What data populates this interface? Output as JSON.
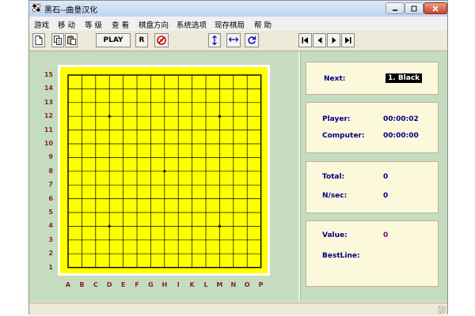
{
  "window": {
    "title": "黑石--曲垦汉化"
  },
  "menu": [
    {
      "label": "游戏"
    },
    {
      "label": "移 动"
    },
    {
      "label": "等 级"
    },
    {
      "label": "查 看"
    },
    {
      "label": "棋盘方向"
    },
    {
      "label": "系统选项"
    },
    {
      "label": "现存棋局"
    },
    {
      "label": "帮 助"
    }
  ],
  "toolbar": {
    "new_icon": "new-document-icon",
    "copy_icon": "copy-icon",
    "paste_icon": "paste-icon",
    "play_label": "PLAY",
    "r_label": "R",
    "stop_icon": "stop-icon",
    "flip_vertical_icon": "flip-vertical-icon",
    "flip_horizontal_icon": "flip-horizontal-icon",
    "rotate_icon": "rotate-icon",
    "first_icon": "go-first-icon",
    "prev_icon": "go-prev-icon",
    "next_icon": "go-next-icon",
    "last_icon": "go-last-icon"
  },
  "board": {
    "size": 15,
    "rows": [
      "15",
      "14",
      "13",
      "12",
      "11",
      "10",
      "9",
      "8",
      "7",
      "6",
      "5",
      "4",
      "3",
      "2",
      "1"
    ],
    "cols": [
      "A",
      "B",
      "C",
      "D",
      "E",
      "F",
      "G",
      "H",
      "I",
      "K",
      "L",
      "M",
      "N",
      "O",
      "P"
    ],
    "star_points": [
      [
        "D",
        12
      ],
      [
        "M",
        12
      ],
      [
        "H",
        8
      ],
      [
        "D",
        4
      ],
      [
        "M",
        4
      ]
    ],
    "board_color": "#ffff00",
    "label_color": "#7a2a2a"
  },
  "info": {
    "next_label": "Next:",
    "next_value": "1. Black",
    "player_label": "Player:",
    "player_time": "00:00:02",
    "computer_label": "Computer:",
    "computer_time": "00:00:00",
    "total_label": "Total:",
    "total_value": "0",
    "nsec_label": "N/sec:",
    "nsec_value": "0",
    "value_label": "Value:",
    "value_value": "0",
    "bestline_label": "BestLine:"
  },
  "colors": {
    "panel_bg": "#c6dcbe",
    "info_bg": "#fcf8dc",
    "info_text": "#000080"
  }
}
